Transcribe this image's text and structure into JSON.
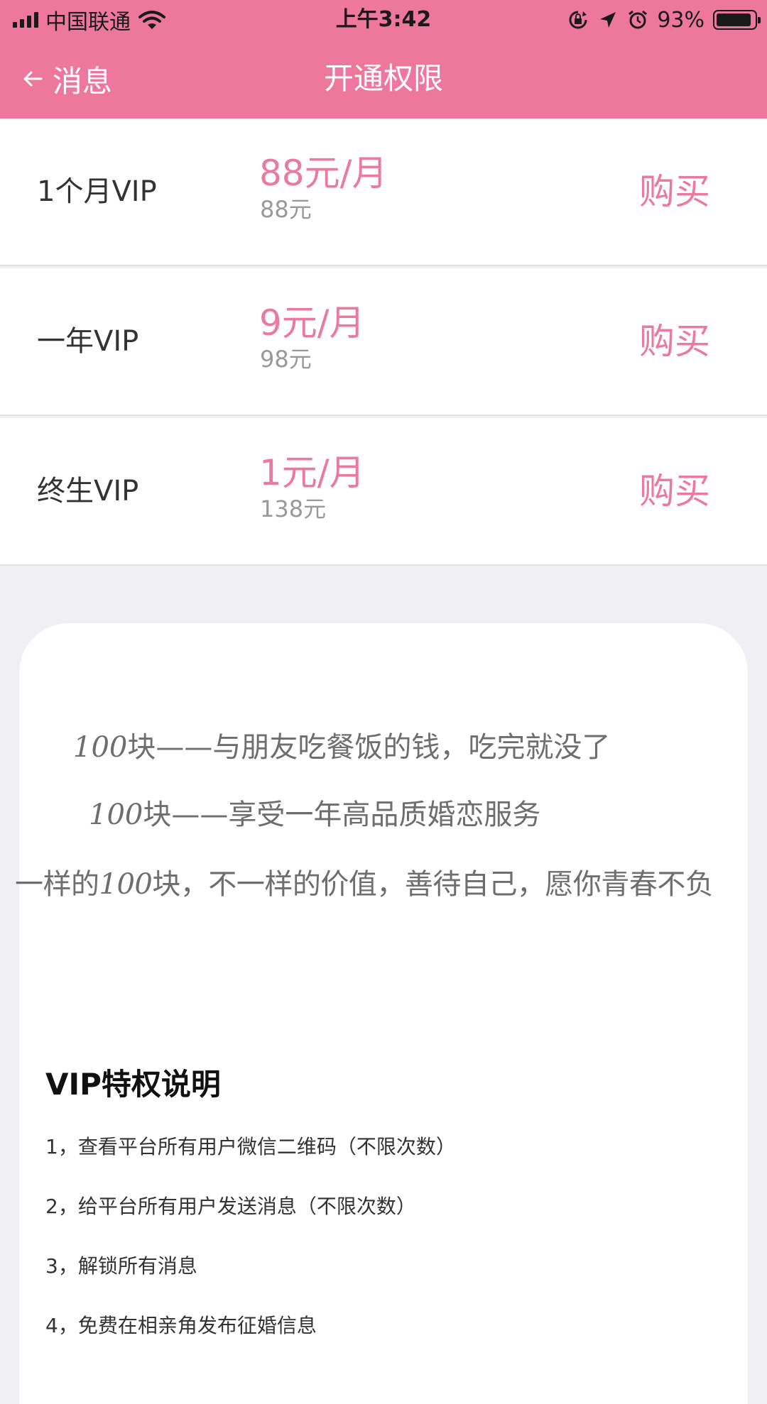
{
  "status_bar": {
    "carrier": "中国联通",
    "time": "上午3:42",
    "battery": "93%",
    "battery_level": 0.93,
    "icons": [
      "signal-icon",
      "wifi-icon",
      "orientation-lock-icon",
      "location-icon",
      "alarm-icon",
      "battery-icon"
    ]
  },
  "nav": {
    "back_label": "消息",
    "title": "开通权限"
  },
  "plans": [
    {
      "name": "1个月VIP",
      "price": "88元/月",
      "total": "88元",
      "buy": "购买"
    },
    {
      "name": "一年VIP",
      "price": "9元/月",
      "total": "98元",
      "buy": "购买"
    },
    {
      "name": "终生VIP",
      "price": "1元/月",
      "total": "138元",
      "buy": "购买"
    }
  ],
  "promo": {
    "line1_num": "100",
    "line1_text": "块——与朋友吃餐饭的钱，吃完就没了",
    "line2_num": "100",
    "line2_text": "块——享受一年高品质婚恋服务",
    "line3_pre": "一样的",
    "line3_num": "100",
    "line3_text": "块，不一样的价值，善待自己，愿你青春不负"
  },
  "privileges": {
    "title": "VIP特权说明",
    "items": [
      "1，查看平台所有用户微信二维码（不限次数）",
      "2，给平台所有用户发送消息（不限次数）",
      "3，解锁所有消息",
      "4，免费在相亲角发布征婚信息"
    ]
  },
  "colors": {
    "accent": "#ee789d",
    "price": "#ea7aa0",
    "muted": "#999999",
    "background": "#f0f0f4"
  }
}
